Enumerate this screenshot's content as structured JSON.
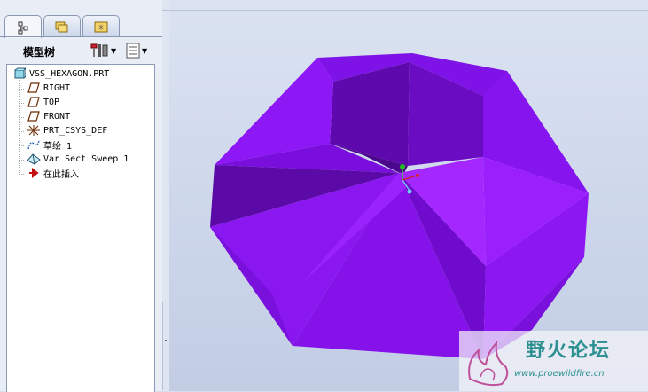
{
  "model_tree": {
    "title": "模型树",
    "items": [
      {
        "label": "VSS_HEXAGON.PRT",
        "icon": "part-icon"
      },
      {
        "label": "RIGHT",
        "icon": "datum-plane-icon"
      },
      {
        "label": "TOP",
        "icon": "datum-plane-icon"
      },
      {
        "label": "FRONT",
        "icon": "datum-plane-icon"
      },
      {
        "label": "PRT_CSYS_DEF",
        "icon": "coordinate-system-icon"
      },
      {
        "label": "草绘 1",
        "icon": "sketch-icon"
      },
      {
        "label": "Var Sect Sweep 1",
        "icon": "sweep-icon"
      },
      {
        "label": "在此插入",
        "icon": "insert-here-arrow-icon"
      }
    ]
  },
  "watermark": {
    "title": "野火论坛",
    "url": "www.proewildfire.cn"
  },
  "colors": {
    "part_light": "#9b1fff",
    "part_mid": "#7c0fe0",
    "part_dark": "#5a0aa8",
    "panel_bg": "#e9edf6",
    "accent_teal": "#2c8f90"
  }
}
